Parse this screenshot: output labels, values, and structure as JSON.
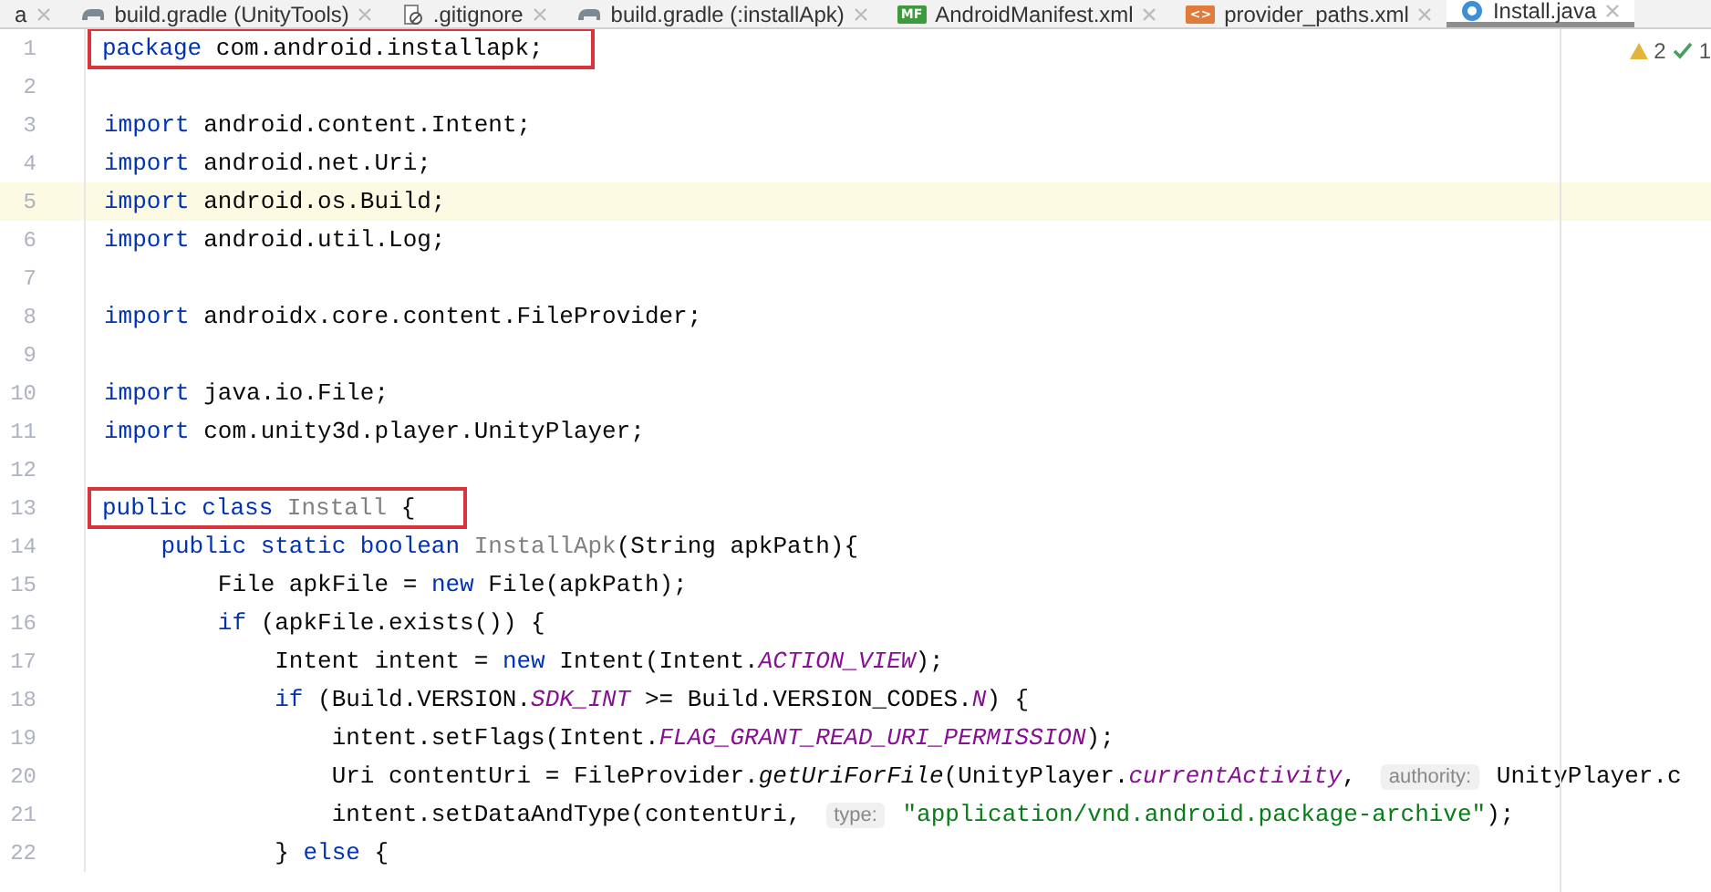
{
  "tabs": [
    {
      "label": "a",
      "kind": "plain",
      "selected": false
    },
    {
      "label": "build.gradle (UnityTools)",
      "kind": "gradle",
      "selected": false
    },
    {
      "label": ".gitignore",
      "kind": "ignore",
      "selected": false
    },
    {
      "label": "build.gradle (:installApk)",
      "kind": "gradle",
      "selected": false
    },
    {
      "label": "AndroidManifest.xml",
      "kind": "manifest",
      "badge": "MF",
      "selected": false
    },
    {
      "label": "provider_paths.xml",
      "kind": "xml",
      "badge": "<>",
      "selected": false
    },
    {
      "label": "Install.java",
      "kind": "class",
      "selected": true
    }
  ],
  "inspections": {
    "warnings": "2",
    "weak_warnings": "1"
  },
  "lines": [
    {
      "number": "1",
      "boxed": true,
      "current": false,
      "tokens": [
        {
          "kind": "kw",
          "text": "package"
        },
        {
          "kind": "text",
          "text": " com.android.installapk;"
        }
      ]
    },
    {
      "number": "2",
      "current": false
    },
    {
      "number": "3",
      "boxed": false,
      "current": false,
      "tokens": [
        {
          "kind": "kw",
          "text": "import"
        },
        {
          "kind": "text",
          "text": " android.content.Intent;"
        }
      ]
    },
    {
      "number": "4",
      "boxed": false,
      "current": false,
      "tokens": [
        {
          "kind": "kw",
          "text": "import"
        },
        {
          "kind": "text",
          "text": " android.net.Uri;"
        }
      ]
    },
    {
      "number": "5",
      "boxed": false,
      "current": true,
      "tokens": [
        {
          "kind": "kw",
          "text": "import"
        },
        {
          "kind": "text",
          "text": " android.os.Build;"
        }
      ]
    },
    {
      "number": "6",
      "boxed": false,
      "current": false,
      "tokens": [
        {
          "kind": "kw",
          "text": "import"
        },
        {
          "kind": "text",
          "text": " android.util.Log;"
        }
      ]
    },
    {
      "number": "7",
      "current": false
    },
    {
      "number": "8",
      "boxed": false,
      "current": false,
      "tokens": [
        {
          "kind": "kw",
          "text": "import"
        },
        {
          "kind": "text",
          "text": " androidx.core.content.FileProvider;"
        }
      ]
    },
    {
      "number": "9",
      "current": false
    },
    {
      "number": "10",
      "boxed": false,
      "current": false,
      "tokens": [
        {
          "kind": "kw",
          "text": "import"
        },
        {
          "kind": "text",
          "text": " java.io.File;"
        }
      ]
    },
    {
      "number": "11",
      "boxed": false,
      "current": false,
      "tokens": [
        {
          "kind": "kw",
          "text": "import"
        },
        {
          "kind": "text",
          "text": " com.unity3d.player.UnityPlayer;"
        }
      ]
    },
    {
      "number": "12",
      "current": false
    },
    {
      "number": "13",
      "boxed": true,
      "current": false,
      "tokens": [
        {
          "kind": "kw",
          "text": "public class"
        },
        {
          "kind": "unused",
          "text": " Install"
        },
        {
          "kind": "text",
          "text": " {"
        }
      ]
    },
    {
      "number": "14",
      "boxed": false,
      "current": false,
      "tokens": [
        {
          "kind": "kw",
          "text": "    public static boolean"
        },
        {
          "kind": "unused",
          "text": " InstallApk"
        },
        {
          "kind": "text",
          "text": "(String apkPath){"
        }
      ]
    },
    {
      "number": "15",
      "boxed": false,
      "current": false,
      "tokens": [
        {
          "kind": "text",
          "text": "        File apkFile = "
        },
        {
          "kind": "kw",
          "text": "new"
        },
        {
          "kind": "text",
          "text": " File(apkPath);"
        }
      ]
    },
    {
      "number": "16",
      "boxed": false,
      "current": false,
      "tokens": [
        {
          "kind": "kw",
          "text": "        if"
        },
        {
          "kind": "text",
          "text": " (apkFile.exists()) {"
        }
      ]
    },
    {
      "number": "17",
      "boxed": false,
      "current": false,
      "tokens": [
        {
          "kind": "text",
          "text": "            Intent intent = "
        },
        {
          "kind": "kw",
          "text": "new"
        },
        {
          "kind": "text",
          "text": " Intent(Intent."
        },
        {
          "kind": "field",
          "text": "ACTION_VIEW"
        },
        {
          "kind": "text",
          "text": ");"
        }
      ]
    },
    {
      "number": "18",
      "boxed": false,
      "current": false,
      "tokens": [
        {
          "kind": "kw",
          "text": "            if"
        },
        {
          "kind": "text",
          "text": " (Build.VERSION."
        },
        {
          "kind": "field",
          "text": "SDK_INT"
        },
        {
          "kind": "text",
          "text": " >= Build.VERSION_CODES."
        },
        {
          "kind": "field",
          "text": "N"
        },
        {
          "kind": "text",
          "text": ") {"
        }
      ]
    },
    {
      "number": "19",
      "boxed": false,
      "current": false,
      "tokens": [
        {
          "kind": "text",
          "text": "                intent.setFlags(Intent."
        },
        {
          "kind": "field",
          "text": "FLAG_GRANT_READ_URI_PERMISSION"
        },
        {
          "kind": "text",
          "text": ");"
        }
      ]
    },
    {
      "number": "20",
      "boxed": false,
      "current": false,
      "tokens": [
        {
          "kind": "text",
          "text": "                Uri contentUri = FileProvider."
        },
        {
          "kind": "call",
          "text": "getUriForFile"
        },
        {
          "kind": "text",
          "text": "(UnityPlayer."
        },
        {
          "kind": "field",
          "text": "currentActivity"
        },
        {
          "kind": "text",
          "text": ", "
        },
        {
          "kind": "hint",
          "text": "authority:"
        },
        {
          "kind": "text",
          "text": " UnityPlayer.c"
        }
      ]
    },
    {
      "number": "21",
      "boxed": false,
      "current": false,
      "tokens": [
        {
          "kind": "text",
          "text": "                intent.setDataAndType(contentUri, "
        },
        {
          "kind": "hint",
          "text": "type:"
        },
        {
          "kind": "str",
          "text": " \"application/vnd.android.package-archive\""
        },
        {
          "kind": "text",
          "text": ");"
        }
      ]
    },
    {
      "number": "22",
      "boxed": false,
      "current": false,
      "tokens": [
        {
          "kind": "text",
          "text": "            } "
        },
        {
          "kind": "kw",
          "text": "else"
        },
        {
          "kind": "text",
          "text": " {"
        }
      ]
    }
  ]
}
